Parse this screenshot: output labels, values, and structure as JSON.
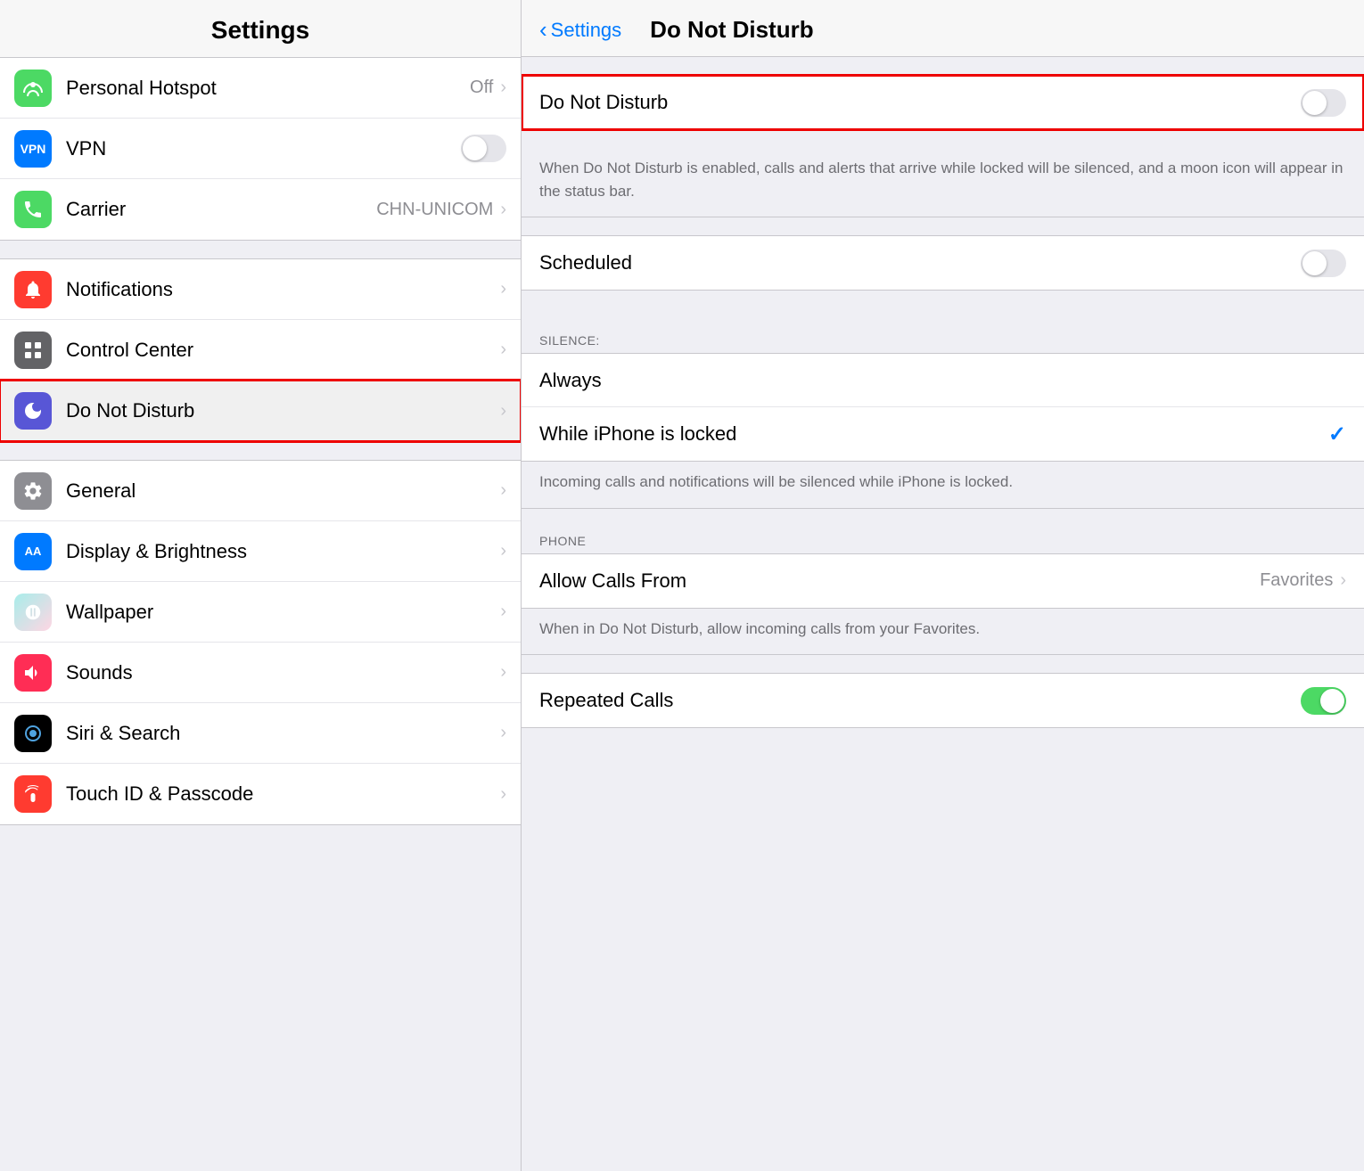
{
  "left": {
    "title": "Settings",
    "sections": [
      {
        "rows": [
          {
            "id": "personal-hotspot",
            "icon_bg": "icon-green",
            "icon": "🔗",
            "label": "Personal Hotspot",
            "value": "Off",
            "has_chevron": true
          },
          {
            "id": "vpn",
            "icon_bg": "vpn",
            "icon": "VPN",
            "label": "VPN",
            "has_toggle": true,
            "toggle_on": false
          },
          {
            "id": "carrier",
            "icon_bg": "icon-phone-green",
            "icon": "📞",
            "label": "Carrier",
            "value": "CHN-UNICOM",
            "has_chevron": true
          }
        ]
      },
      {
        "rows": [
          {
            "id": "notifications",
            "icon_bg": "icon-red",
            "icon": "🔔",
            "label": "Notifications",
            "has_chevron": true
          },
          {
            "id": "control-center",
            "icon_bg": "icon-gray",
            "icon": "⊞",
            "label": "Control Center",
            "has_chevron": true
          },
          {
            "id": "do-not-disturb",
            "icon_bg": "icon-purple",
            "icon": "🌙",
            "label": "Do Not Disturb",
            "has_chevron": true,
            "highlighted": true
          }
        ]
      },
      {
        "rows": [
          {
            "id": "general",
            "icon_bg": "icon-gray",
            "icon": "⚙",
            "label": "General",
            "has_chevron": true
          },
          {
            "id": "display-brightness",
            "icon_bg": "icon-blue-aa",
            "icon": "AA",
            "label": "Display & Brightness",
            "has_chevron": true
          },
          {
            "id": "wallpaper",
            "icon_bg": "icon-teal",
            "icon": "❋",
            "label": "Wallpaper",
            "has_chevron": true
          },
          {
            "id": "sounds",
            "icon_bg": "icon-pink",
            "icon": "🔊",
            "label": "Sounds",
            "has_chevron": true
          },
          {
            "id": "siri-search",
            "icon_bg": "icon-siri",
            "icon": "◉",
            "label": "Siri & Search",
            "has_chevron": true
          },
          {
            "id": "touch-id",
            "icon_bg": "icon-touch",
            "icon": "◎",
            "label": "Touch ID & Passcode",
            "has_chevron": true
          }
        ]
      }
    ]
  },
  "right": {
    "back_label": "Settings",
    "title": "Do Not Disturb",
    "sections": [
      {
        "type": "main-toggle",
        "label": "Do Not Disturb",
        "toggle_on": false,
        "highlighted": true,
        "description": "When Do Not Disturb is enabled, calls and alerts that arrive while locked will be silenced, and a moon icon will appear in the status bar."
      },
      {
        "type": "scheduled",
        "label": "Scheduled",
        "toggle_on": false
      },
      {
        "type": "silence",
        "section_header": "SILENCE:",
        "rows": [
          {
            "id": "always",
            "label": "Always",
            "checked": false
          },
          {
            "id": "while-locked",
            "label": "While iPhone is locked",
            "checked": true
          }
        ],
        "description": "Incoming calls and notifications will be silenced while iPhone is locked."
      },
      {
        "type": "phone",
        "section_header": "PHONE",
        "rows": [
          {
            "id": "allow-calls",
            "label": "Allow Calls From",
            "value": "Favorites",
            "has_chevron": true
          }
        ],
        "description": "When in Do Not Disturb, allow incoming calls from your Favorites."
      },
      {
        "type": "repeated-calls",
        "label": "Repeated Calls",
        "toggle_on": true
      }
    ]
  }
}
